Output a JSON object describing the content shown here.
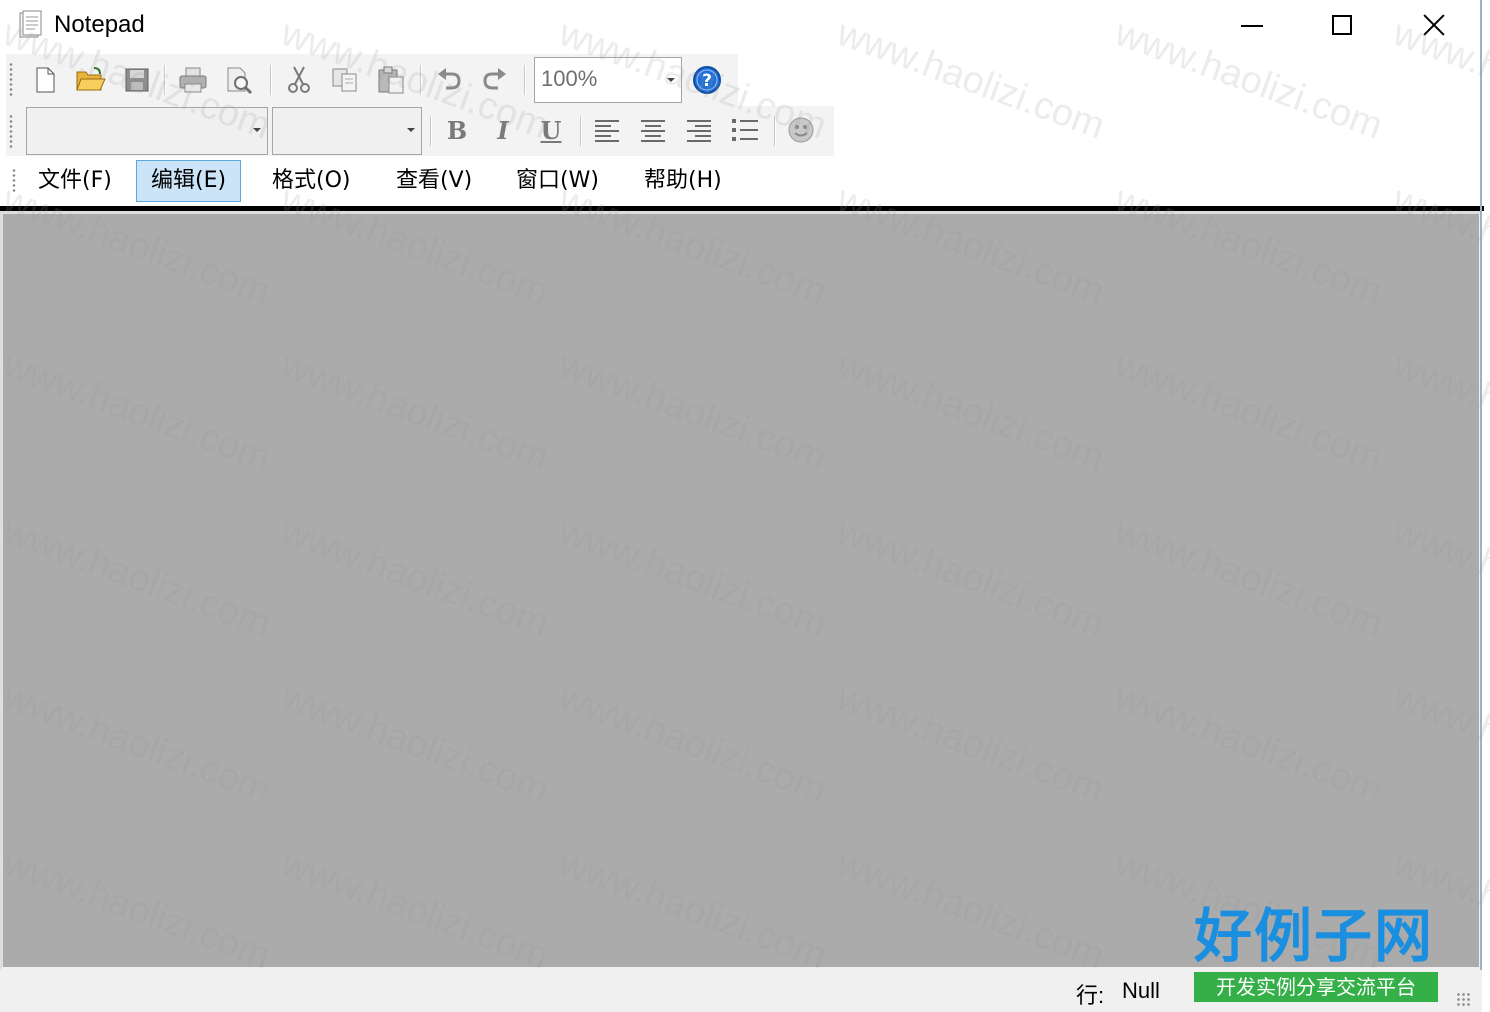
{
  "window": {
    "title": "Notepad"
  },
  "toolbar": {
    "zoom_value": "100%",
    "font_name_value": "",
    "font_size_value": "",
    "bold_label": "B",
    "italic_label": "I",
    "underline_label": "U",
    "icons": [
      "new-file-icon",
      "open-folder-icon",
      "save-icon",
      "print-icon",
      "print-preview-icon",
      "cut-icon",
      "copy-icon",
      "paste-icon",
      "undo-icon",
      "redo-icon",
      "help-icon",
      "align-left-icon",
      "align-center-icon",
      "align-right-icon",
      "bullet-list-icon",
      "insert-image-icon"
    ]
  },
  "menu": {
    "items": [
      {
        "label": "文件(F)",
        "active": false
      },
      {
        "label": "编辑(E)",
        "active": true
      },
      {
        "label": "格式(O)",
        "active": false
      },
      {
        "label": "查看(V)",
        "active": false
      },
      {
        "label": "窗口(W)",
        "active": false
      },
      {
        "label": "帮助(H)",
        "active": false
      }
    ]
  },
  "statusbar": {
    "row_label": "行:",
    "row_value": "Null"
  },
  "watermark": {
    "text": "www.haolizi.com",
    "brand_main": "好例子网",
    "brand_sub": "开发实例分享交流平台"
  },
  "colors": {
    "mdi_background": "#ababab",
    "menu_active_bg": "#cce4f7",
    "menu_active_border": "#5ea8dd",
    "help_icon_blue": "#1e6fd9",
    "brand_blue": "#1a8fe0",
    "brand_green": "#35b049"
  }
}
